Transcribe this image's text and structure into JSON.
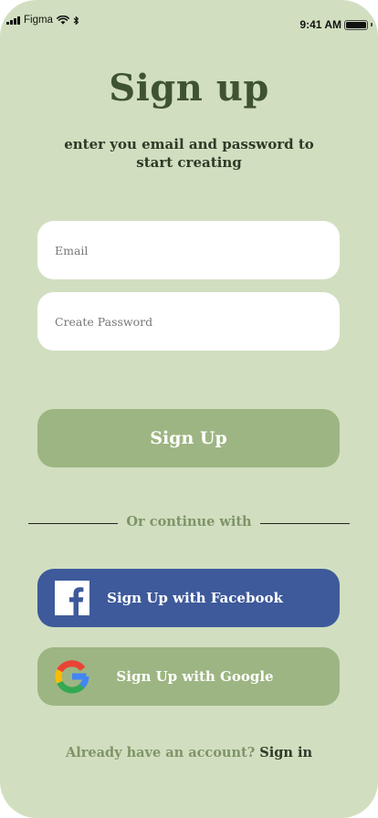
{
  "status_bar": {
    "carrier": "Figma",
    "time": "9:41 AM"
  },
  "header": {
    "title": "Sign up",
    "subtitle": "enter you email and password to start creating"
  },
  "form": {
    "email_placeholder": "Email",
    "email_value": "",
    "password_placeholder": "Create Password",
    "password_value": "",
    "submit_label": "Sign Up"
  },
  "divider": {
    "text": "Or continue with"
  },
  "social": {
    "facebook_label": "Sign Up with Facebook",
    "facebook_icon": "facebook-icon",
    "google_label": "Sign Up with Google",
    "google_icon": "google-icon"
  },
  "footer": {
    "prompt": "Already have an account?",
    "link": "Sign in"
  },
  "colors": {
    "background": "#d1dfc0",
    "title": "#3f5331",
    "primary_button": "#9db582",
    "facebook_button": "#3e5a9b",
    "muted_text": "#7f9468"
  }
}
